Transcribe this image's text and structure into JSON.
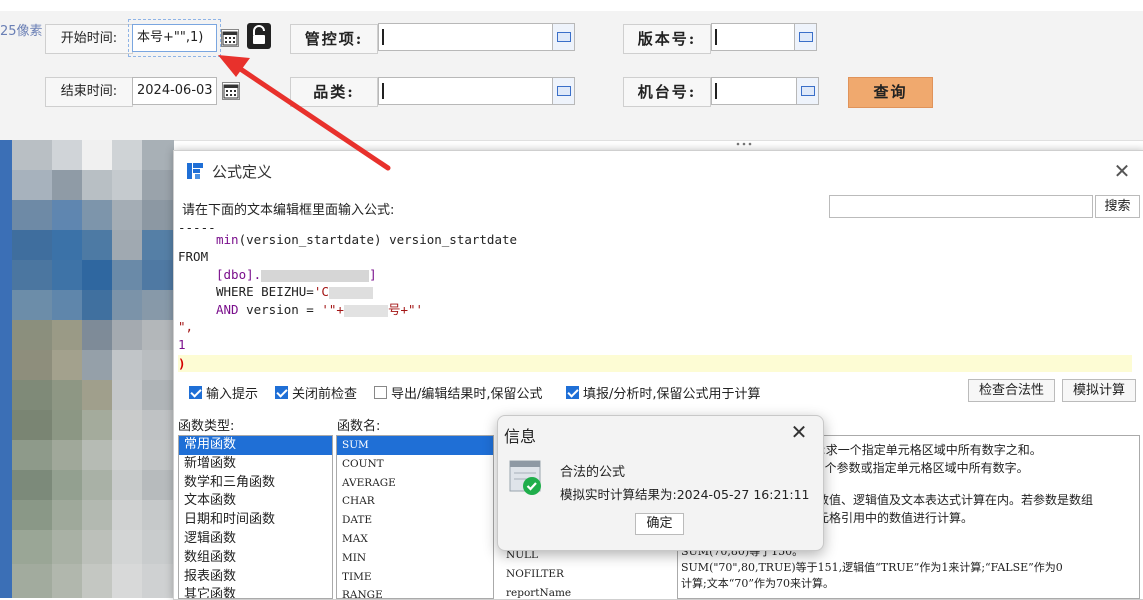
{
  "query_form": {
    "start_time_label": "开始时间:",
    "start_time_value": "本号+\"\",1)",
    "end_time_label": "结束时间:",
    "end_time_value": "2024-06-03",
    "control_item_label": "管控项:",
    "category_label": "品类:",
    "version_label": "版本号:",
    "machine_label": "机台号:",
    "query_button": "查询",
    "side_fragment": "25像素"
  },
  "formula_dialog": {
    "title": "公式定义",
    "hint": "请在下面的文本编辑框里面输入公式:",
    "search_button": "搜索",
    "code": {
      "l0": "-----",
      "l1_fn": "min",
      "l1_rest": "(version_startdate) version_startdate",
      "l2": "FROM",
      "l3_a": "[dbo].",
      "l3_b": "]",
      "l4_a": "WHERE BEIZHU=",
      "l4_b": "'C",
      "l5_kw": "AND",
      "l5_rest": " version = ",
      "l5_str": "'\"+",
      "l5_str2": "号+\"'",
      "l6": "\",",
      "l7": "1",
      "l8": ")"
    },
    "options": {
      "input_hint": "输入提示",
      "check_on_close": "关闭前检查",
      "keep_formula_export": "导出/编辑结果时,保留公式",
      "keep_formula_fill": "填报/分析时,保留公式用于计算"
    },
    "check_button": "检查合法性",
    "simulate_button": "模拟计算",
    "func_type_label": "函数类型:",
    "func_name_label": "函数名:",
    "func_types": [
      "常用函数",
      "新增函数",
      "数学和三角函数",
      "文本函数",
      "日期和时间函数",
      "逻辑函数",
      "数组函数",
      "报表函数",
      "其它函数"
    ],
    "func_names": [
      "SUM",
      "COUNT",
      "AVERAGE",
      "CHAR",
      "DATE",
      "MAX",
      "MIN",
      "TIME",
      "RANGE"
    ],
    "extra_names": [
      "NULL",
      "NOFILTER",
      "reportName"
    ],
    "description": [
      "):求一个指定单元格区域中所有数字之和。",
      "n个参数或指定单元格区域中所有数字。",
      "数值、逻辑值及文本表达式计算在内。若参数是数组",
      "元格引用中的数值进行计算。",
      "SUM(70,80)等于150。",
      "SUM(\"70\",80,TRUE)等于151,逻辑值“TRUE”作为1来计算;“FALSE”作为0",
      "计算;文本“70”作为70来计算。"
    ]
  },
  "info_dialog": {
    "title": "信息",
    "message": "合法的公式",
    "result": "模拟实时计算结果为:2024-05-27  16:21:11",
    "ok_button": "确定"
  },
  "colors": {
    "accent_blue": "#1f6fd6",
    "query_button": "#f0a96e",
    "arrow": "#e8312c",
    "success_green": "#1fae4b"
  }
}
